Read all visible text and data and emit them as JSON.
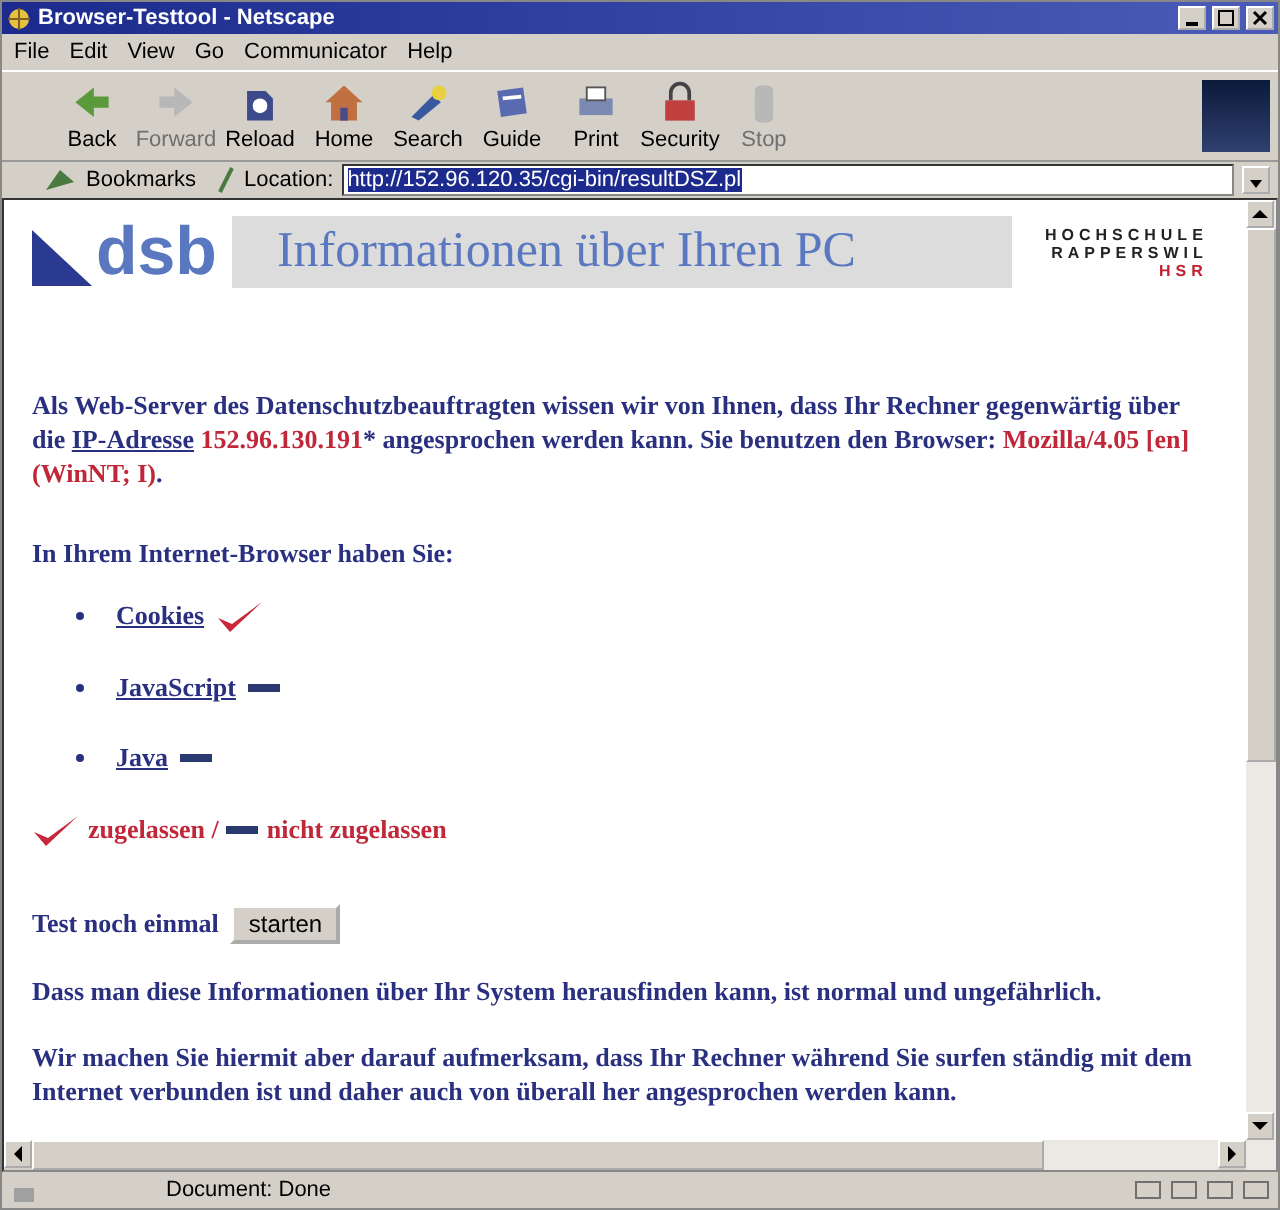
{
  "window": {
    "title": "Browser-Testtool - Netscape"
  },
  "menu": [
    "File",
    "Edit",
    "View",
    "Go",
    "Communicator",
    "Help"
  ],
  "toolbar": [
    {
      "label": "Back",
      "disabled": false,
      "kind": "back"
    },
    {
      "label": "Forward",
      "disabled": true,
      "kind": "forward"
    },
    {
      "label": "Reload",
      "disabled": false,
      "kind": "reload"
    },
    {
      "label": "Home",
      "disabled": false,
      "kind": "home"
    },
    {
      "label": "Search",
      "disabled": false,
      "kind": "search"
    },
    {
      "label": "Guide",
      "disabled": false,
      "kind": "guide"
    },
    {
      "label": "Print",
      "disabled": false,
      "kind": "print"
    },
    {
      "label": "Security",
      "disabled": false,
      "kind": "security"
    },
    {
      "label": "Stop",
      "disabled": true,
      "kind": "stop"
    }
  ],
  "location_bar": {
    "bookmarks": "Bookmarks",
    "label": "Location:",
    "url": "http://152.96.120.35/cgi-bin/resultDSZ.pl"
  },
  "page": {
    "logo": "dsb",
    "banner": "Informationen über Ihren PC",
    "school": [
      "HOCHSCHULE",
      "RAPPERSWIL",
      "HSR"
    ],
    "intro": [
      {
        "kind": "plain",
        "text": "Als Web-Server des Datenschutzbeauftragten wissen wir von Ihnen, dass Ihr Rechner gegenwärtig über die "
      },
      {
        "kind": "link",
        "text": "IP-Adresse"
      },
      {
        "kind": "highlight",
        "text": " 152.96.130.191"
      },
      {
        "kind": "plain",
        "text": "* angesprochen werden kann. Sie benutzen den Browser: "
      },
      {
        "kind": "highlight",
        "text": "Mozilla/4.05 [en] (WinNT; I)"
      },
      {
        "kind": "plain",
        "text": "."
      }
    ],
    "features_heading": "In Ihrem Internet-Browser haben Sie:",
    "features": [
      {
        "name": "Cookies",
        "allowed": true
      },
      {
        "name": "JavaScript",
        "allowed": false
      },
      {
        "name": "Java",
        "allowed": false
      }
    ],
    "legend": {
      "allowed": "zugelassen /",
      "denied": "nicht zugelassen"
    },
    "retest": {
      "label": "Test noch einmal",
      "button": "starten"
    },
    "notes": [
      "Dass man diese Informationen über Ihr System herausfinden kann, ist normal und  ungefährlich.",
      "Wir machen Sie hiermit aber darauf aufmerksam, dass Ihr Rechner während Sie surfen ständig mit dem Internet verbunden ist und daher auch von überall her angesprochen werden kann."
    ]
  },
  "status_bar": {
    "text": "Document: Done"
  }
}
